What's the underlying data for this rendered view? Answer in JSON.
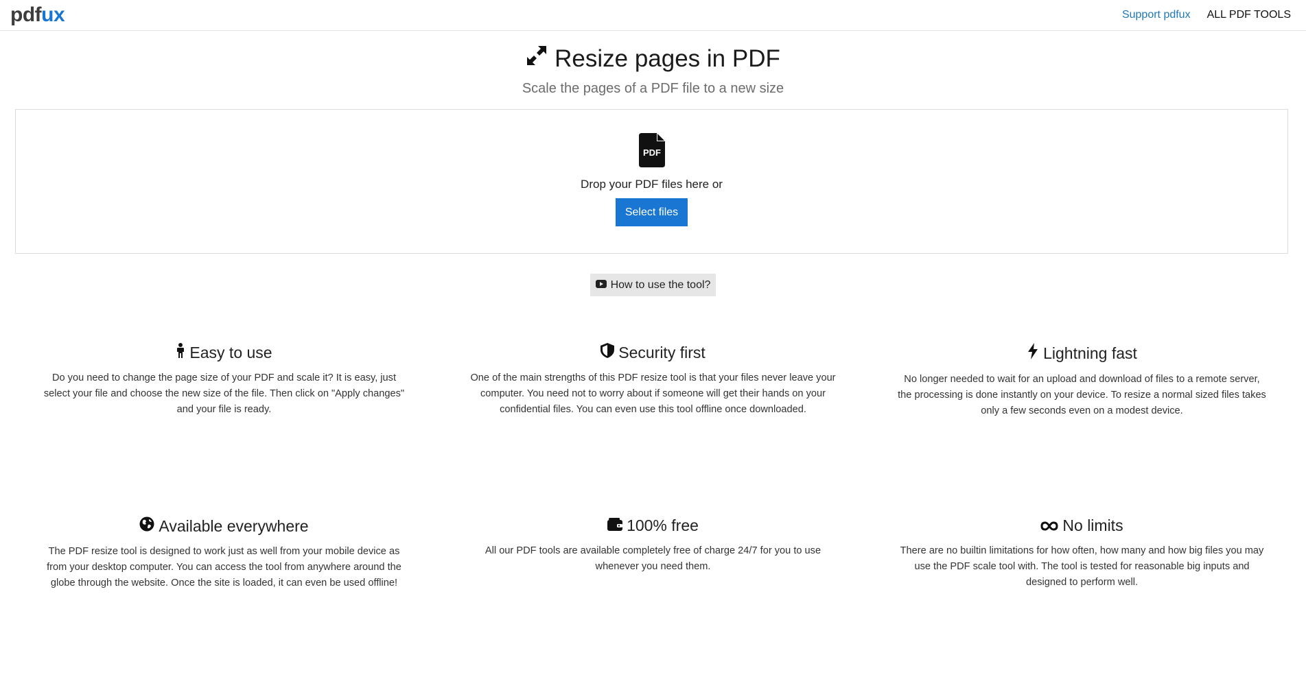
{
  "nav": {
    "brand_part1": "pdf",
    "brand_part2": "ux",
    "support": "Support pdfux",
    "all_tools": "ALL PDF TOOLS"
  },
  "hero": {
    "title": "Resize pages in PDF",
    "subtitle": "Scale the pages of a PDF file to a new size",
    "icon": "expand-arrows-icon"
  },
  "dropzone": {
    "icon": "pdf-file-icon",
    "icon_text": "PDF",
    "text": "Drop your PDF files here or",
    "button": "Select files"
  },
  "howto": {
    "label": "How to use the tool?",
    "icon": "youtube-icon"
  },
  "features": [
    {
      "icon": "person-icon",
      "title": "Easy to use",
      "text": "Do you need to change the page size of your PDF and scale it? It is easy, just select your file and choose the new size of the file. Then click on \"Apply changes\" and your file is ready."
    },
    {
      "icon": "shield-icon",
      "title": "Security first",
      "text": "One of the main strengths of this PDF resize tool is that your files never leave your computer. You need not to worry about if someone will get their hands on your confidential files. You can even use this tool offline once downloaded."
    },
    {
      "icon": "lightning-icon",
      "title": "Lightning fast",
      "text": "No longer needed to wait for an upload and download of files to a remote server, the processing is done instantly on your device. To resize a normal sized files takes only a few seconds even on a modest device."
    },
    {
      "icon": "globe-icon",
      "title": "Available everywhere",
      "text": "The PDF resize tool is designed to work just as well from your mobile device as from your desktop computer. You can access the tool from anywhere around the globe through the website. Once the site is loaded, it can even be used offline!"
    },
    {
      "icon": "wallet-icon",
      "title": "100% free",
      "text": "All our PDF tools are available completely free of charge 24/7 for you to use whenever you need them."
    },
    {
      "icon": "infinity-icon",
      "title": "No limits",
      "text": "There are no builtin limitations for how often, how many and how big files you may use the PDF scale tool with. The tool is tested for reasonable big inputs and designed to perform well."
    }
  ],
  "colors": {
    "accent": "#1976d2",
    "brand_dark": "#3d3d3d"
  }
}
